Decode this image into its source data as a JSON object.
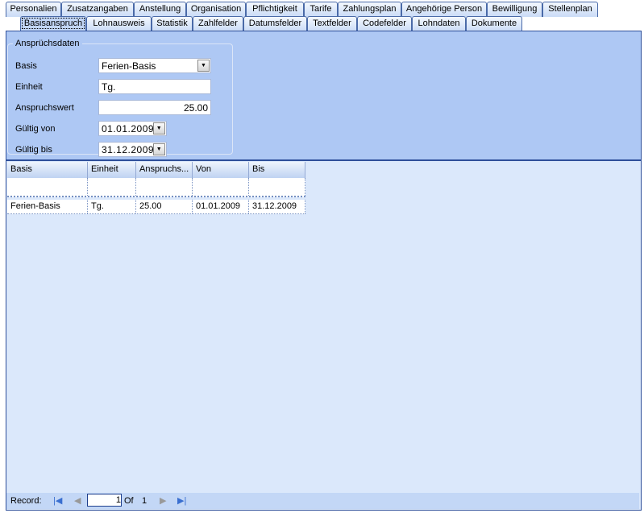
{
  "tabs_row1": [
    "Personalien",
    "Zusatzangaben",
    "Anstellung",
    "Organisation",
    "Pflichtigkeit",
    "Tarife",
    "Zahlungsplan",
    "Angehörige Person",
    "Bewilligung",
    "Stellenplan"
  ],
  "tabs_row2": [
    "Basisanspruch",
    "Lohnausweis",
    "Statistik",
    "Zahlfelder",
    "Datumsfelder",
    "Textfelder",
    "Codefelder",
    "Lohndaten",
    "Dokumente"
  ],
  "form": {
    "group_title": "Ansprüchsdaten",
    "basis_label": "Basis",
    "basis_value": "Ferien-Basis",
    "einheit_label": "Einheit",
    "einheit_value": "Tg.",
    "anspruchswert_label": "Anspruchswert",
    "anspruchswert_value": "25.00",
    "von_label": "Gültig von",
    "von_value": "01.01.2009",
    "bis_label": "Gültig bis",
    "bis_value": "31.12.2009"
  },
  "grid": {
    "columns": [
      "Basis",
      "Einheit",
      "Anspruchs...",
      "Von",
      "Bis"
    ],
    "rows": [
      [
        "Ferien-Basis",
        "Tg.",
        "25.00",
        "01.01.2009",
        "31.12.2009"
      ]
    ]
  },
  "navigator": {
    "label": "Record:",
    "current": "1",
    "of_label": "Of",
    "total": "1"
  }
}
